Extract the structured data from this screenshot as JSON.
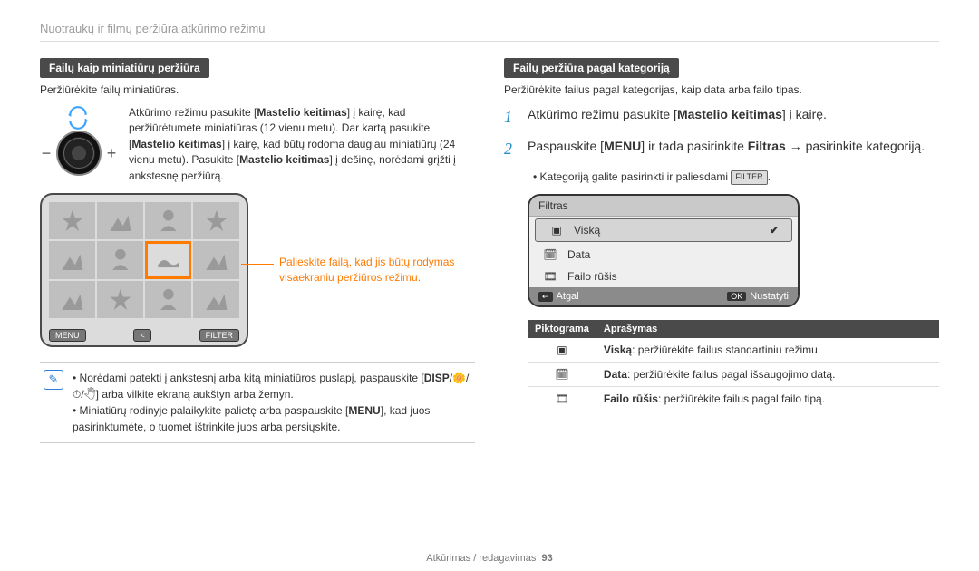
{
  "header": "Nuotraukų ir filmų peržiūra atkūrimo režimu",
  "left": {
    "title": "Failų kaip miniatiūrų peržiūra",
    "intro": "Peržiūrėkite failų miniatiūras.",
    "lens_text_1": "Atkūrimo režimu pasukite [",
    "lens_bold_1": "Mastelio keitimas",
    "lens_text_2": "] į kairę, kad peržiūrėtumėte miniatiūras (12 vienu metu). Dar kartą pasukite [",
    "lens_bold_2": "Mastelio keitimas",
    "lens_text_3": "] į kairę, kad būtų rodoma daugiau miniatiūrų (24 vienu metu). Pasukite [",
    "lens_bold_3": "Mastelio keitimas",
    "lens_text_4": "] į dešinę, norėdami grįžti į ankstesnę peržiūrą.",
    "cam_menu": "MENU",
    "cam_filter": "FILTER",
    "thumb_callout": "Palieskite failą, kad jis būtų rodymas visaekraniu peržiūros režimu.",
    "note1_a": "Norėdami patekti į ankstesnį arba kitą miniatiūros puslapį, paspauskite [",
    "note1_disp": "DISP",
    "note1_b": "/🌼/⏱/🖑] arba vilkite ekraną aukštyn arba žemyn.",
    "note2_a": "Miniatiūrų rodinyje palaikykite palietę arba paspauskite [",
    "note2_menu": "MENU",
    "note2_b": "], kad juos pasirinktumėte, o tuomet ištrinkite juos arba persiųskite."
  },
  "right": {
    "title": "Failų peržiūra pagal kategoriją",
    "intro": "Peržiūrėkite failus pagal kategorijas, kaip data arba failo tipas.",
    "step1_a": "Atkūrimo režimu pasukite [",
    "step1_bold": "Mastelio keitimas",
    "step1_b": "] į kairę.",
    "step2_a": "Paspauskite [",
    "step2_menu": "MENU",
    "step2_b": "] ir tada pasirinkite ",
    "step2_bold": "Filtras",
    "step2_c": " → pasirinkite kategoriją.",
    "bullet_a": "Kategoriją galite pasirinkti ir paliesdami ",
    "bullet_btn": "FILTER",
    "bullet_b": ".",
    "menu": {
      "title": "Filtras",
      "item1": "Viską",
      "item2": "Data",
      "item3": "Failo rūšis",
      "back": "Atgal",
      "set": "Nustatyti"
    },
    "table": {
      "h1": "Piktograma",
      "h2": "Aprašymas",
      "r1_bold": "Viską",
      "r1": ": peržiūrėkite failus standartiniu režimu.",
      "r2_bold": "Data",
      "r2": ": peržiūrėkite failus pagal išsaugojimo datą.",
      "r3_bold": "Failo rūšis",
      "r3": ": peržiūrėkite failus pagal failo tipą."
    }
  },
  "footer_a": "Atkūrimas / redagavimas",
  "footer_b": "93"
}
